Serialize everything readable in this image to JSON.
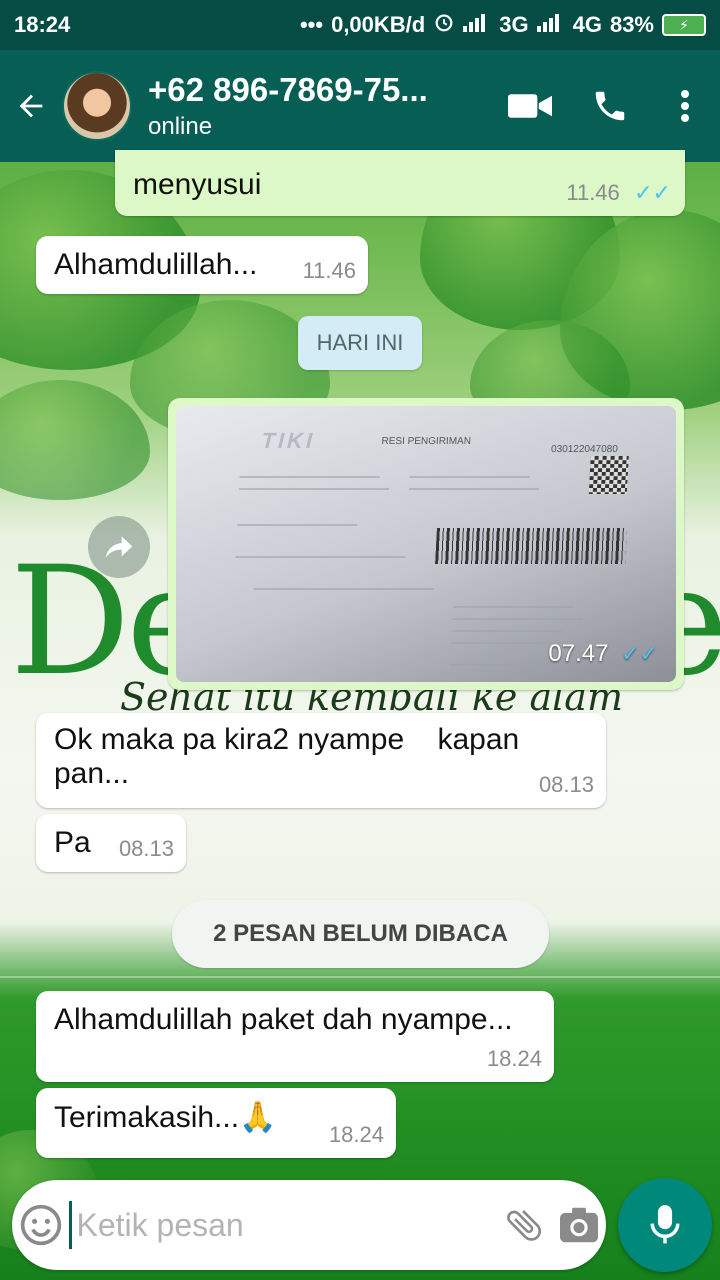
{
  "status_bar": {
    "time": "18:24",
    "dots": "•••",
    "network_speed": "0,00KB/d",
    "signal_1": "3G",
    "signal_2": "4G",
    "battery": "83%"
  },
  "header": {
    "contact_name": "+62 896-7869-75...",
    "contact_status": "online"
  },
  "wallpaper": {
    "brand_left": "De",
    "brand_right": "e",
    "tagline": "Sehat itu kembali ke alam"
  },
  "messages": [
    {
      "text": "menyusui",
      "time": "11.46",
      "ticks": "✓✓"
    },
    {
      "text": "Alhamdulillah...",
      "time": "11.46"
    },
    {
      "image_time": "07.47",
      "ticks": "✓✓"
    },
    {
      "text_line1": "Ok maka pa kira2 nyampe    kapan",
      "text_line2": "pan...",
      "time": "08.13"
    },
    {
      "text": "Pa",
      "time": "08.13"
    },
    {
      "text": "Alhamdulillah paket dah nyampe...",
      "time": "18.24"
    },
    {
      "text": "Terimakasih...🙏",
      "time": "18.24"
    }
  ],
  "date_chip": "HARI INI",
  "unread_chip": "2 PESAN BELUM DIBACA",
  "receipt": {
    "logo": "TIKI",
    "title": "RESI PENGIRIMAN",
    "number": "030122047080"
  },
  "input": {
    "placeholder": "Ketik pesan"
  },
  "colors": {
    "header": "#075e54",
    "status_bar": "#054d44",
    "outgoing_bubble": "#dcf8c6",
    "incoming_bubble": "#ffffff",
    "read_ticks": "#4fc3f7",
    "mic_button": "#00897b"
  },
  "icons": {
    "back": "arrow-left",
    "video": "video-camera",
    "call": "phone",
    "menu": "vertical-dots",
    "forward": "forward-arrow",
    "emoji": "smiley",
    "attach": "paperclip",
    "camera": "camera",
    "mic": "microphone"
  }
}
